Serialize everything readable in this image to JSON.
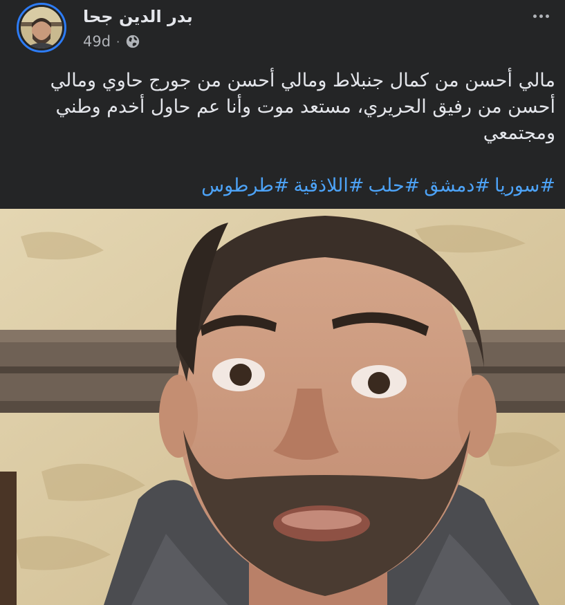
{
  "post": {
    "author_name": "بدر الدين جحا",
    "time": "49d",
    "separator": "·",
    "privacy_icon": "globe-icon",
    "more_icon": "more-options-icon",
    "text": "مالي أحسن من كمال جنبلاط ومالي أحسن من جورج حاوي ومالي أحسن من رفيق الحريري، مستعد موت وأنا عم حاول أخدم وطني ومجتمعي",
    "hashtags": [
      "#سوريا",
      "#دمشق",
      "#حلب",
      "#اللاذقية",
      "#طرطوس"
    ]
  },
  "colors": {
    "background": "#242526",
    "text": "#e4e6eb",
    "secondary_text": "#b0b3b8",
    "link": "#4da3f7",
    "story_ring": "#2d7cf6"
  }
}
